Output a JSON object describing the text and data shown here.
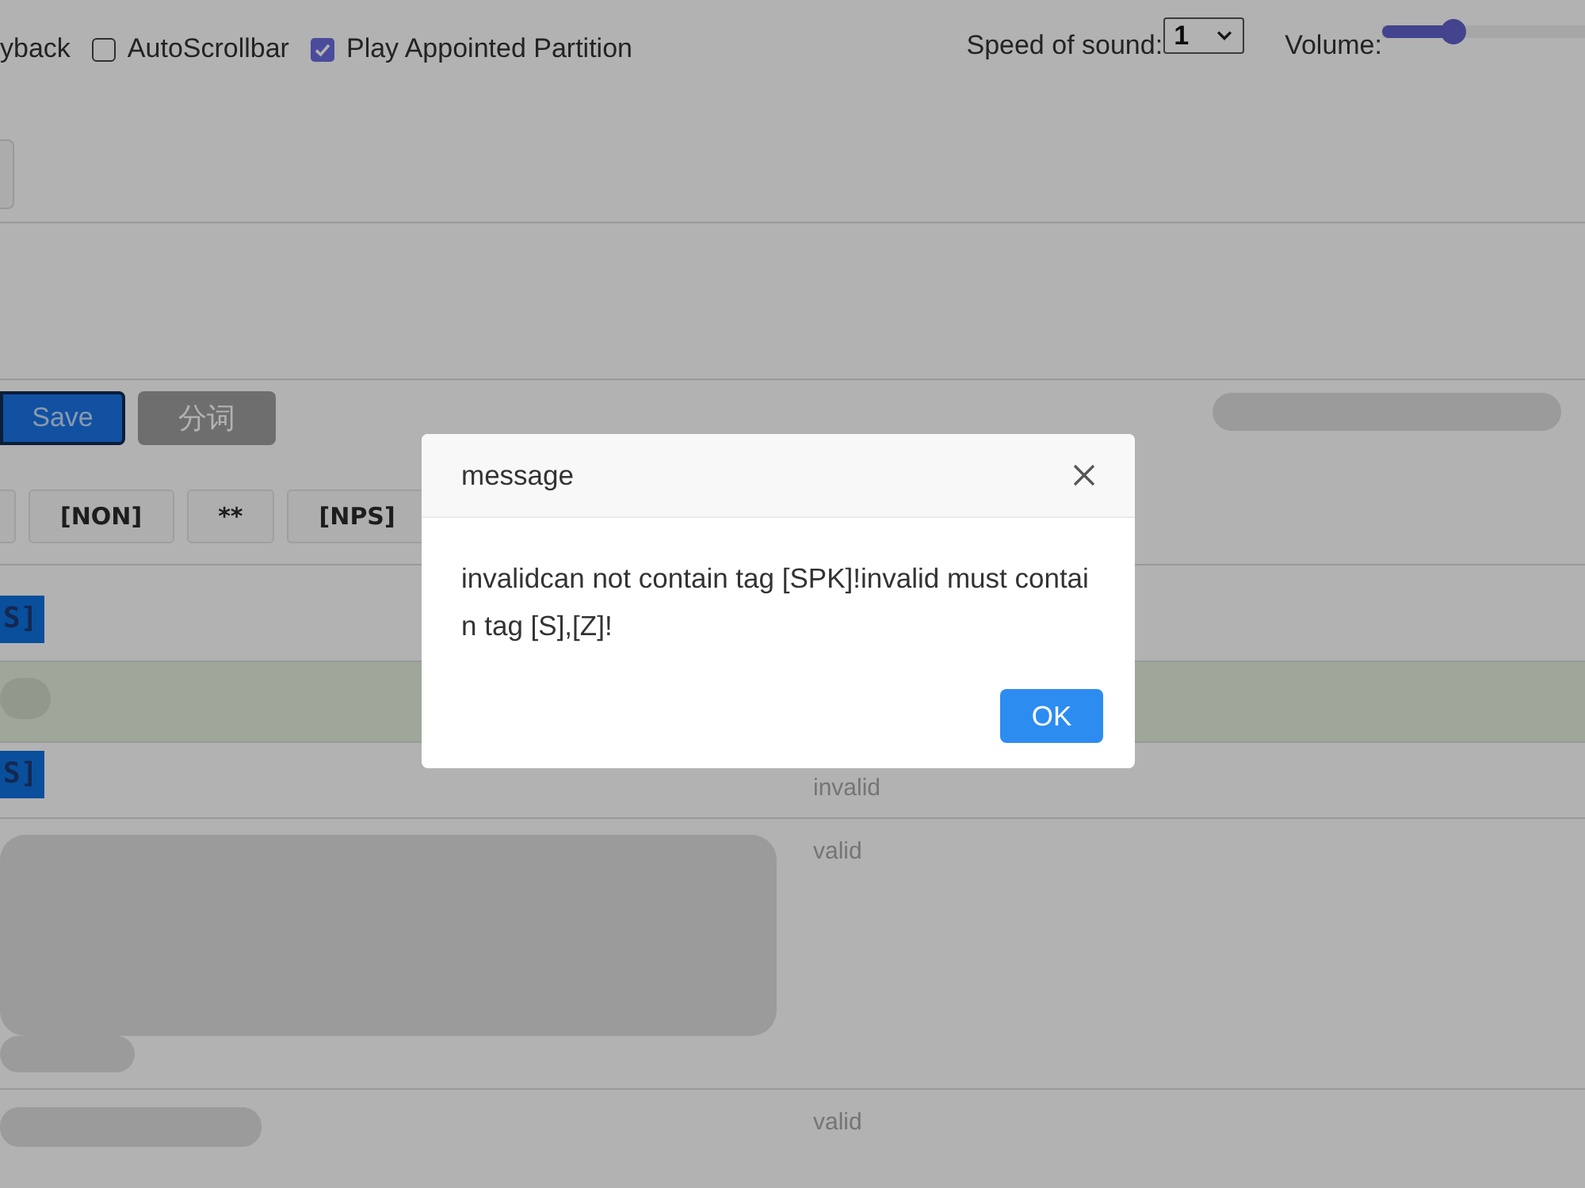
{
  "header": {
    "playback_label": "yback",
    "options": [
      {
        "label": "AutoScrollbar",
        "checked": false
      },
      {
        "label": "Play Appointed Partition",
        "checked": true
      }
    ],
    "speed": {
      "label": "Speed of sound:",
      "value": "1"
    },
    "volume": {
      "label": "Volume:",
      "level": 0.35
    }
  },
  "toolbar": {
    "buttons": [
      {
        "label": "Save",
        "kind": "primary",
        "focused": true
      },
      {
        "label": "分词",
        "kind": "secondary",
        "focused": false
      }
    ]
  },
  "tags": [
    "[NON]",
    "**",
    "[NPS]"
  ],
  "rows": [
    {
      "kind": "tag",
      "tag": "S]",
      "selected": false
    },
    {
      "kind": "blurred-word",
      "selected": true
    },
    {
      "kind": "tag",
      "tag": "S]",
      "status": "invalid",
      "selected": false
    },
    {
      "kind": "blurred-paragraph",
      "status": "valid",
      "selected": false
    },
    {
      "kind": "blurred-line",
      "status": "valid",
      "selected": false
    }
  ],
  "dialog": {
    "title": "message",
    "text": "invalidcan not contain tag [SPK]!invalid must contain tag [S],[Z]!",
    "ok": "OK"
  }
}
